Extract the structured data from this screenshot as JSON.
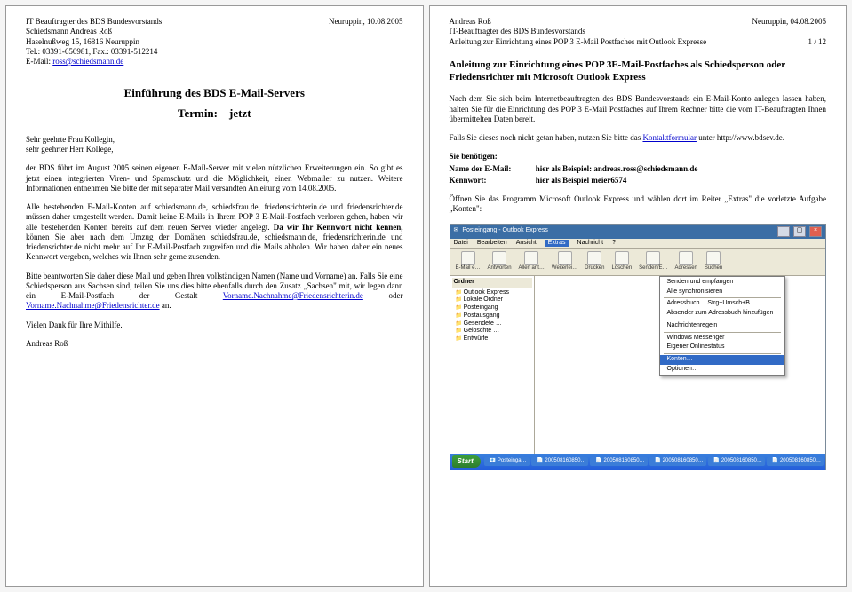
{
  "left": {
    "header": {
      "org": "IT Beauftragter des BDS Bundesvorstands",
      "name": "Schiedsmann Andreas Roß",
      "addr": "Haselnußweg 15, 16816 Neuruppin",
      "tel": "Tel.: 03391-650981, Fax.: 03391-512214",
      "email_label": "E-Mail: ",
      "email": "ross@schiedsmann.de",
      "place_date": "Neuruppin, 10.08.2005"
    },
    "title": "Einführung des BDS E-Mail-Servers",
    "termin_label": "Termin:",
    "termin_value": "jetzt",
    "greet1": "Sehr geehrte Frau Kollegin,",
    "greet2": "sehr geehrter Herr Kollege,",
    "p1": "der BDS führt im August 2005 seinen eigenen E-Mail-Server mit vielen nützlichen Erweiterungen ein. So gibt es jetzt einen integrierten Viren- und Spamschutz und die Möglichkeit, einen Webmailer zu nutzen. Weitere Informationen entnehmen Sie bitte der mit separater Mail versandten Anleitung vom 14.08.2005.",
    "p2a": "Alle bestehenden E-Mail-Konten auf schiedsmann.de, schiedsfrau.de, friedensrichterin.de und friedensrichter.de müssen daher umgestellt werden. ",
    "p2b": "Damit keine E-Mails in Ihrem POP 3 E-Mail-Postfach verloren gehen, haben wir alle bestehenden Konten bereits auf dem neuen Server wieder angelegt. ",
    "p2c": "Da wir Ihr Kennwort nicht kennen, ",
    "p2d": "können Sie aber nach dem Umzug der Domänen schiedsfrau.de, schiedsmann.de, friedensrichterin.de und friedensrichter.de nicht mehr auf Ihr E-Mail-Postfach zugreifen und die Mails abholen. Wir haben daher ein neues Kennwort vergeben, welches wir Ihnen sehr gerne zusenden.",
    "p3a": "Bitte beantworten Sie daher diese Mail und geben Ihren vollständigen Namen (Name und Vorname) an. Falls Sie eine Schiedsperson aus Sachsen sind, teilen Sie uns dies bitte ebenfalls durch den Zusatz „Sachsen\" mit, wir legen dann ein E-Mail-Postfach der Gestalt ",
    "link1": "Vorname.Nachnahme@Friedensrichterin.de",
    "p3b": " oder ",
    "link2": "Vorname.Nachnahme@Friedensrichter.de",
    "p3c": " an.",
    "p4": "Vielen Dank für Ihre Mithilfe.",
    "sign": "Andreas Roß"
  },
  "right": {
    "header": {
      "author": "Andreas Roß",
      "place_date": "Neuruppin, 04.08.2005",
      "org": "IT-Beauftragter des BDS Bundesvorstands",
      "doc": "Anleitung zur Einrichtung eines POP 3 E-Mail Postfaches mit Outlook Expresse",
      "page": "1 / 12"
    },
    "title": "Anleitung zur Einrichtung eines POP 3E-Mail-Postfaches als Schiedsperson oder Friedensrichter mit Microsoft Outlook Express",
    "p1": "Nach dem Sie sich beim Internetbeauftragten des BDS Bundesvorstands ein E-Mail-Konto anlegen lassen haben, halten Sie für die Einrichtung des POP 3 E-Mail Postfaches auf Ihrem Rechner bitte die vom IT-Beauftragten Ihnen übermittelten Daten bereit.",
    "p2a": "Falls Sie dieses noch nicht getan haben, nutzen Sie bitte das ",
    "p2link": "Kontaktformular",
    "p2b": " unter http://www.bdsev.de.",
    "need": "Sie benötigen:",
    "need_name_lbl": "Name der E-Mail:",
    "need_name_val": "hier als Beispiel: andreas.ross@schiedsmann.de",
    "need_pw_lbl": "Kennwort:",
    "need_pw_val": "hier als Beispiel meier6574",
    "p3": "Öffnen Sie das Programm Microsoft Outlook Express und wählen dort im Reiter „Extras\" die vorletzte Aufgabe „Konten\":"
  },
  "oe": {
    "title": "Posteingang - Outlook Express",
    "menu": [
      "Datei",
      "Bearbeiten",
      "Ansicht",
      "Extras",
      "Nachricht",
      "?"
    ],
    "menu_hi_index": 3,
    "toolbar": [
      "E-Mail e…",
      "Antworten",
      "Allen ant…",
      "Weiterlei…",
      "Drucken",
      "Löschen",
      "Senden/E…",
      "Adressen",
      "Suchen"
    ],
    "treehdr": "Ordner",
    "tree": [
      "Outlook Express",
      "Lokale Ordner",
      "Posteingang",
      "Postausgang",
      "Gesendete …",
      "Gelöschte …",
      "Entwürfe"
    ],
    "dropdown": [
      "Senden und empfangen",
      "Alle synchronisieren",
      "-",
      "Adressbuch…           Strg+Umsch+B",
      "Absender zum Adressbuch hinzufügen",
      "-",
      "Nachrichtenregeln",
      "-",
      "Windows Messenger",
      "Eigener Onlinestatus",
      "-",
      "Konten…",
      "Optionen…"
    ],
    "dropdown_sel_index": 11,
    "taskbar": {
      "start": "Start",
      "items": [
        "📧 Posteinga…",
        "📄 200508160850…",
        "📄 200508160850…",
        "📄 200508160850…",
        "📄 200508160850…",
        "📄 200508160850…"
      ]
    }
  }
}
